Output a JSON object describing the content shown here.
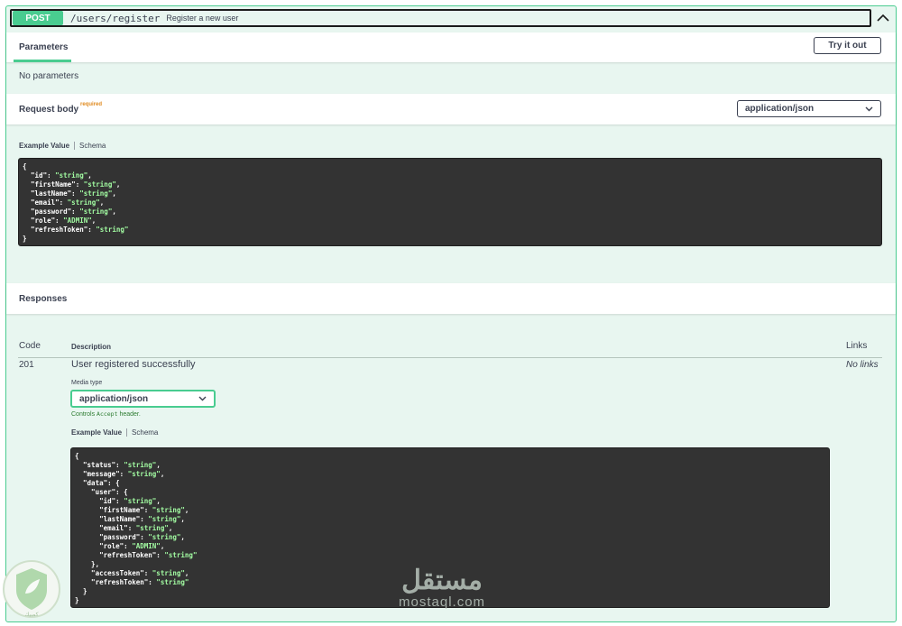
{
  "operation": {
    "method": "POST",
    "path": "/users/register",
    "summary": "Register a new user"
  },
  "parameters": {
    "tab_label": "Parameters",
    "try_button": "Try it out",
    "empty_text": "No parameters"
  },
  "request_body": {
    "title": "Request body",
    "required_label": "required",
    "content_type": "application/json",
    "tab_example": "Example Value",
    "tab_schema": "Schema",
    "example": "{\n  \"id\": \"string\",\n  \"firstName\": \"string\",\n  \"lastName\": \"string\",\n  \"email\": \"string\",\n  \"password\": \"string\",\n  \"role\": \"ADMIN\",\n  \"refreshToken\": \"string\"\n}"
  },
  "responses": {
    "title": "Responses",
    "columns": {
      "code": "Code",
      "description": "Description",
      "links": "Links"
    },
    "rows": [
      {
        "code": "201",
        "description": "User registered successfully",
        "links": "No links",
        "media_type_label": "Media type",
        "media_type": "application/json",
        "controls_prefix": "Controls",
        "controls_code": "Accept",
        "controls_suffix": "header.",
        "tab_example": "Example Value",
        "tab_schema": "Schema",
        "example": "{\n  \"status\": \"string\",\n  \"message\": \"string\",\n  \"data\": {\n    \"user\": {\n      \"id\": \"string\",\n      \"firstName\": \"string\",\n      \"lastName\": \"string\",\n      \"email\": \"string\",\n      \"password\": \"string\",\n      \"role\": \"ADMIN\",\n      \"refreshToken\": \"string\"\n    },\n    \"accessToken\": \"string\",\n    \"refreshToken\": \"string\"\n  }\n}"
      }
    ]
  },
  "watermark": {
    "arabic": "مستقل",
    "latin": "mostaql.com",
    "badge_text": "كمبيك"
  },
  "colors": {
    "post": "#49cc90",
    "block_bg": "#e8f6f0",
    "code_bg": "#333333",
    "string": "#a2fca2",
    "required": "#e08a1e"
  }
}
